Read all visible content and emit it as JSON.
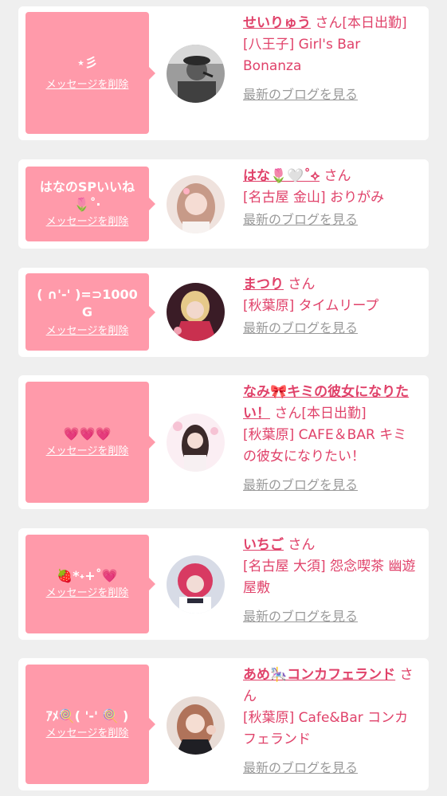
{
  "list": [
    {
      "message": "⋆彡",
      "delete_label": "メッセージを削除",
      "name": "せいりゅう",
      "suffix": "さん[本日出勤]",
      "shop": "[八王子] Girl's Bar Bonanza",
      "blog_label": "最新のブログを見る"
    },
    {
      "message": "はなのSPいいね🌷˚‧",
      "delete_label": "メッセージを削除",
      "name": "はな🌷🤍˚⟡",
      "suffix": "さん",
      "shop": "[名古屋 金山] おりがみ",
      "blog_label": "最新のブログを見る"
    },
    {
      "message": "( ∩'-' )=⊃1000G",
      "delete_label": "メッセージを削除",
      "name": "まつり",
      "suffix": "さん",
      "shop": "[秋葉原] タイムリープ",
      "blog_label": "最新のブログを見る"
    },
    {
      "message": "💗💗💗",
      "delete_label": "メッセージを削除",
      "name": "なみ🎀キミの彼女になりたい！",
      "suffix": "さん[本日出勤]",
      "shop": "[秋葉原] CAFE＆BAR キミの彼女になりたい！",
      "blog_label": "最新のブログを見る"
    },
    {
      "message": "🍓*˖+˚💗",
      "delete_label": "メッセージを削除",
      "name": "いちご",
      "suffix": "さん",
      "shop": "[名古屋 大須] 怨念喫茶 幽遊屋敷",
      "blog_label": "最新のブログを見る"
    },
    {
      "message": "ｱﾒ🍭( '-' 🍭 )",
      "delete_label": "メッセージを削除",
      "name": "あめ🎠コンカフェランド",
      "suffix": "さん",
      "shop": "[秋葉原] Cafe&Bar コンカフェランド",
      "blog_label": "最新のブログを見る"
    }
  ],
  "colors": {
    "page_bg": "#efefef",
    "bubble": "#ff9aaa",
    "accent_text": "#e0426a",
    "muted_link": "#9a9a9a"
  }
}
